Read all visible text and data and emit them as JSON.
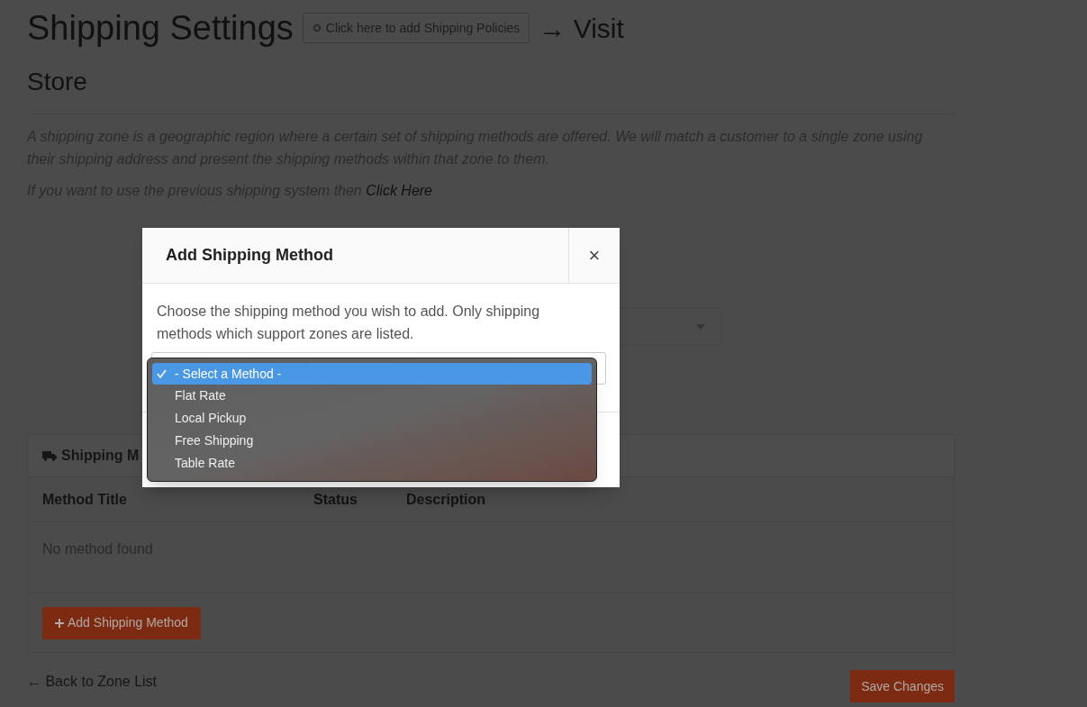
{
  "page": {
    "title": "Shipping Settings",
    "policies_button": "Click here to add Shipping Policies",
    "visit_link": "→ Visit",
    "subtitle": "Store",
    "description": "A shipping zone is a geographic region where a certain set of shipping methods are offered. We will match a customer to a single zone using their shipping address and present the shipping methods within that zone to them.",
    "previous_text": "If you want to use the previous shipping system then",
    "previous_link": "Click Here"
  },
  "methods_panel": {
    "title": "Shipping M",
    "columns": [
      "Method Title",
      "Status",
      "Description"
    ],
    "empty_text": "No method found",
    "add_button": "Add Shipping Method"
  },
  "back_link": "← Back to Zone List",
  "save_button": "Save Changes",
  "modal": {
    "title": "Add Shipping Method",
    "close": "×",
    "text": "Choose the shipping method you wish to add. Only shipping methods which support zones are listed.",
    "options": [
      {
        "label": "- Select a Method -",
        "selected": true
      },
      {
        "label": "Flat Rate",
        "selected": false
      },
      {
        "label": "Local Pickup",
        "selected": false
      },
      {
        "label": "Free Shipping",
        "selected": false
      },
      {
        "label": "Table Rate",
        "selected": false
      }
    ]
  }
}
